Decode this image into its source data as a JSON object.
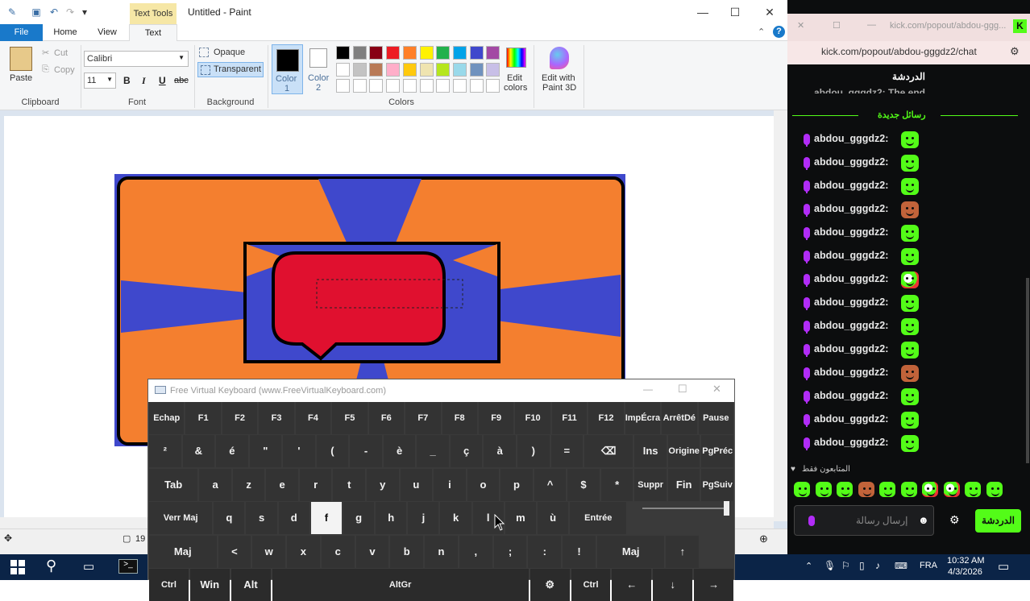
{
  "paint": {
    "window_title": "Untitled - Paint",
    "context_tab": "Text Tools",
    "tabs": [
      "File",
      "Home",
      "View",
      "Text"
    ],
    "clipboard": {
      "paste": "Paste",
      "cut": "Cut",
      "copy": "Copy",
      "group": "Clipboard"
    },
    "font": {
      "family": "Calibri",
      "size": "11",
      "group": "Font",
      "bold": "B",
      "italic": "I",
      "underline": "U",
      "strike": "abc"
    },
    "background": {
      "opaque": "Opaque",
      "transparent": "Transparent",
      "group": "Background"
    },
    "colors": {
      "color1": "Color\n1",
      "color1_a": "Color",
      "color1_b": "1",
      "color2_a": "Color",
      "color2_b": "2",
      "group": "Colors",
      "edit_a": "Edit",
      "edit_b": "colors",
      "p3d_a": "Edit with",
      "p3d_b": "Paint 3D",
      "row1": [
        "#000000",
        "#7f7f7f",
        "#880015",
        "#ed1c24",
        "#ff7f27",
        "#fff200",
        "#22b14c",
        "#00a2e8",
        "#3f48cc",
        "#a349a4"
      ],
      "row2": [
        "#ffffff",
        "#c3c3c3",
        "#b97a57",
        "#ffaec9",
        "#ffc90e",
        "#efe4b0",
        "#b5e61d",
        "#99d9ea",
        "#7092be",
        "#c8bfe7"
      ]
    },
    "status_zoom": "19"
  },
  "chat": {
    "tab_url_short": "kick.com/popout/abdou-ggg...",
    "address": "kick.com/popout/abdou-gggdz2/chat",
    "header": "الدردشة",
    "partial_msg": "abdou_gggdz2: The end",
    "new_messages": "رسائل جديدة",
    "messages": [
      {
        "user": "abdou_gggdz2:",
        "emote": "green"
      },
      {
        "user": "abdou_gggdz2:",
        "emote": "green"
      },
      {
        "user": "abdou_gggdz2:",
        "emote": "green"
      },
      {
        "user": "abdou_gggdz2:",
        "emote": "brown"
      },
      {
        "user": "abdou_gggdz2:",
        "emote": "green"
      },
      {
        "user": "abdou_gggdz2:",
        "emote": "green"
      },
      {
        "user": "abdou_gggdz2:",
        "emote": "mixed"
      },
      {
        "user": "abdou_gggdz2:",
        "emote": "green"
      },
      {
        "user": "abdou_gggdz2:",
        "emote": "green"
      },
      {
        "user": "abdou_gggdz2:",
        "emote": "green"
      },
      {
        "user": "abdou_gggdz2:",
        "emote": "brown"
      },
      {
        "user": "abdou_gggdz2:",
        "emote": "green"
      },
      {
        "user": "abdou_gggdz2:",
        "emote": "green"
      },
      {
        "user": "abdou_gggdz2:",
        "emote": "green"
      }
    ],
    "followers_only": "المتابعون فقط",
    "input_placeholder": "إرسال رسالة",
    "send": "الدردشة"
  },
  "keyboard": {
    "title": "Free Virtual Keyboard (www.FreeVirtualKeyboard.com)",
    "rows": [
      [
        "Echap",
        "F1",
        "F2",
        "F3",
        "F4",
        "F5",
        "F6",
        "F7",
        "F8",
        "F9",
        "F10",
        "F11",
        "F12",
        "ImpÉcra",
        "ArrêtDé",
        "Pause"
      ],
      [
        "²",
        "&",
        "é",
        "\"",
        "'",
        "(",
        "-",
        "è",
        "_",
        "ç",
        "à",
        ")",
        "=",
        "⌫",
        "Ins",
        "Origine",
        "PgPréc"
      ],
      [
        "Tab",
        "a",
        "z",
        "e",
        "r",
        "t",
        "y",
        "u",
        "i",
        "o",
        "p",
        "^",
        "$",
        "*",
        "Suppr",
        "Fin",
        "PgSuiv"
      ],
      [
        "Verr Maj",
        "q",
        "s",
        "d",
        "f",
        "g",
        "h",
        "j",
        "k",
        "l",
        "m",
        "ù",
        "Entrée"
      ],
      [
        "Maj",
        "<",
        "w",
        "x",
        "c",
        "v",
        "b",
        "n",
        ",",
        ";",
        ":",
        "!",
        "Maj",
        "↑"
      ],
      [
        "Ctrl",
        "Win",
        "Alt",
        "AltGr",
        "⚙",
        "Ctrl",
        "←",
        "↓",
        "→"
      ]
    ]
  },
  "taskbar": {
    "lang": "FRA",
    "time": "10:32 AM",
    "date": "4/3/2026"
  }
}
